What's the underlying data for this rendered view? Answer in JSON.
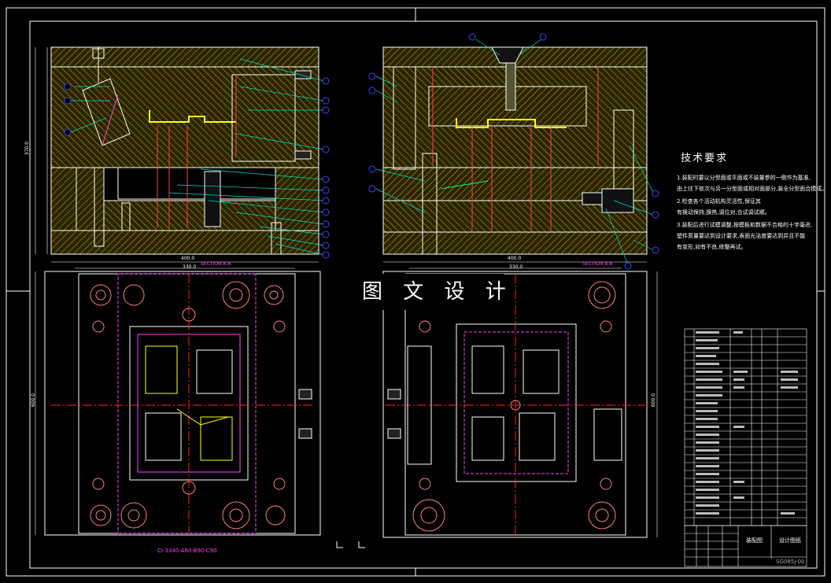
{
  "watermark": "图 文 设 计",
  "requirements": {
    "title": "技术要求",
    "lines": [
      "1.装配时要以分型面或平面或不装量参的一侧作为基准,",
      "由上往下依次与另一分型面或相对面部分,装全分型面合模成。",
      "2.检查各个活动机构灵活性,保证其",
      "有换动保持,换热,调位对,合试调试顺。",
      "3.装配后进行试模调整,按模板和数据不合格的十字毫进,",
      "塑件质量要达到设计要求,表面光洁度要达到并且不能",
      "有变形,如有不良,修整再试。"
    ]
  },
  "sections": {
    "a": "SECTION A-A",
    "b": "SECTION B-B"
  },
  "dims": {
    "top_width_left": "400.0",
    "sub_width_left": "330.0",
    "top_width_right": "400.0",
    "sub_width_right": "330.0",
    "height_side": "600.0",
    "height_side_right": "600.0",
    "left_total": "370.0"
  },
  "part_code": "CI-3340-A60-B90-C90",
  "title_block": {
    "drawing_name": "装配图",
    "company": "设计图纸",
    "code": "SG085J-00"
  },
  "colors": {
    "frame": "#ffffff",
    "hatch": "#c8b400",
    "centerline": "#ff2020",
    "leader": "#00e0d0",
    "hidden": "#ff40ff",
    "bolt": "#ff8080",
    "dim": "#2050ff"
  }
}
